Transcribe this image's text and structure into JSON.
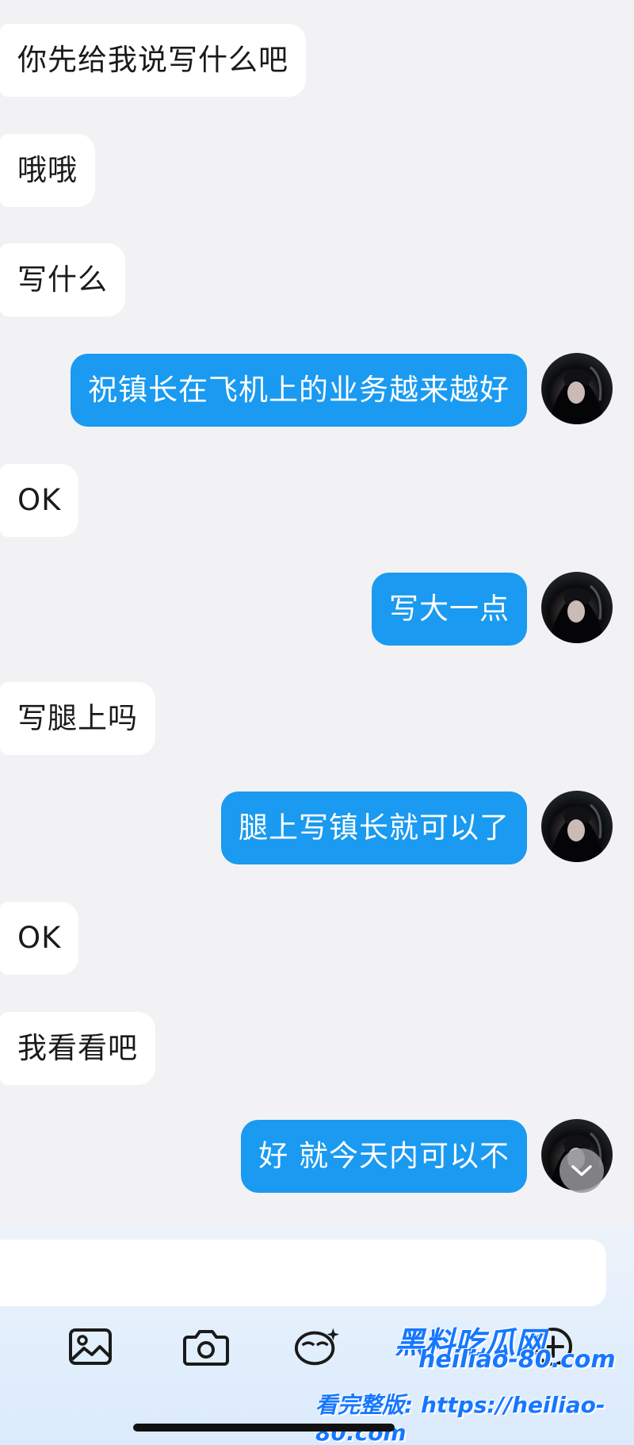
{
  "messages": [
    {
      "side": "incoming",
      "text": "你先给我说写什么吧"
    },
    {
      "side": "incoming",
      "text": "哦哦"
    },
    {
      "side": "incoming",
      "text": "写什么"
    },
    {
      "side": "outgoing",
      "text": "祝镇长在飞机上的业务越来越好"
    },
    {
      "side": "incoming",
      "text": "OK"
    },
    {
      "side": "outgoing",
      "text": "写大一点"
    },
    {
      "side": "incoming",
      "text": "写腿上吗"
    },
    {
      "side": "outgoing",
      "text": "腿上写镇长就可以了"
    },
    {
      "side": "incoming",
      "text": "OK"
    },
    {
      "side": "incoming",
      "text": "我看看吧"
    },
    {
      "side": "outgoing",
      "text": "好 就今天内可以不"
    }
  ],
  "colors": {
    "outgoing_bubble": "#1a9af0",
    "incoming_bubble": "#ffffff",
    "chat_background": "#f2f2f4",
    "watermark": "#1677ff"
  },
  "toolbar": {
    "icons": [
      "image-icon",
      "camera-icon",
      "sticker-icon",
      "plus-icon"
    ]
  },
  "watermark": {
    "title": "黑料吃瓜网",
    "url": "heiliao-80.com",
    "cta": "看完整版: https://heiliao-80.com"
  }
}
